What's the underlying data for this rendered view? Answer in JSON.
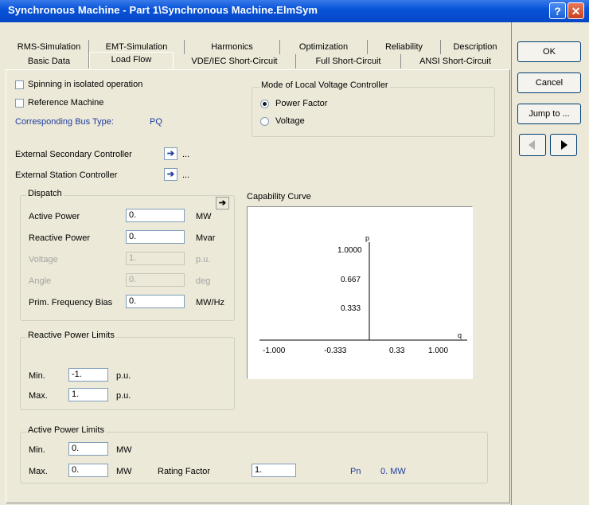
{
  "window": {
    "title": "Synchronous Machine - Part 1\\Synchronous Machine.ElmSym",
    "help_label": "?",
    "close_label": "✕"
  },
  "tabs": {
    "row1": [
      "RMS-Simulation",
      "EMT-Simulation",
      "Harmonics",
      "Optimization",
      "Reliability",
      "Description"
    ],
    "row2": [
      "Basic Data",
      "Load Flow",
      "VDE/IEC Short-Circuit",
      "Full Short-Circuit",
      "ANSI Short-Circuit"
    ],
    "active": "Load Flow"
  },
  "side_buttons": {
    "ok": "OK",
    "cancel": "Cancel",
    "jump": "Jump to ..."
  },
  "options": {
    "spinning": {
      "label": "Spinning in isolated operation",
      "checked": false
    },
    "reference": {
      "label": "Reference Machine",
      "checked": false
    },
    "bus_type_label": "Corresponding Bus Type:",
    "bus_type_value": "PQ"
  },
  "voltage_controller": {
    "title": "Mode of Local Voltage Controller",
    "power_factor": "Power Factor",
    "voltage": "Voltage",
    "selected": "Power Factor"
  },
  "controllers": {
    "secondary": "External Secondary Controller",
    "station": "External Station Controller",
    "arrow_icon": "right-arrow-icon",
    "ellipsis": "..."
  },
  "dispatch": {
    "title": "Dispatch",
    "rows": [
      {
        "label": "Active Power",
        "value": "0.",
        "unit": "MW",
        "enabled": true
      },
      {
        "label": "Reactive Power",
        "value": "0.",
        "unit": "Mvar",
        "enabled": true
      },
      {
        "label": "Voltage",
        "value": "1.",
        "unit": "p.u.",
        "enabled": false
      },
      {
        "label": "Angle",
        "value": "0.",
        "unit": "deg",
        "enabled": false
      },
      {
        "label": "Prim. Frequency Bias",
        "value": "0.",
        "unit": "MW/Hz",
        "enabled": true
      }
    ]
  },
  "capability": {
    "title": "Capability Curve",
    "p_axis_label": "p",
    "q_axis_label": "q",
    "p_ticks": [
      "1.0000",
      "0.667",
      "0.333"
    ],
    "q_ticks": [
      "-1.000",
      "-0.333",
      "0.33",
      "1.000"
    ]
  },
  "reactive_limits": {
    "title": "Reactive Power Limits",
    "min_label": "Min.",
    "min_value": "-1.",
    "max_label": "Max.",
    "max_value": "1.",
    "unit": "p.u."
  },
  "active_limits": {
    "title": "Active Power Limits",
    "min_label": "Min.",
    "min_value": "0.",
    "max_label": "Max.",
    "max_value": "0.",
    "unit": "MW",
    "rating_label": "Rating Factor",
    "rating_value": "1.",
    "pn_label": "Pn",
    "pn_value": "0. MW"
  }
}
